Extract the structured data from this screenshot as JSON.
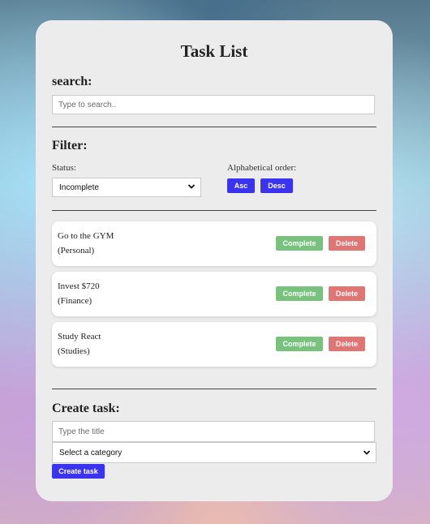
{
  "title": "Task List",
  "search": {
    "heading": "search:",
    "placeholder": "Type to search.."
  },
  "filter": {
    "heading": "Filter:",
    "status_label": "Status:",
    "status_value": "Incomplete",
    "order_label": "Alphabetical order:",
    "asc_label": "Asc",
    "desc_label": "Desc"
  },
  "tasks": [
    {
      "title": "Go to the GYM",
      "category": "(Personal)",
      "complete_label": "Complete",
      "delete_label": "Delete"
    },
    {
      "title": "Invest $720",
      "category": "(Finance)",
      "complete_label": "Complete",
      "delete_label": "Delete"
    },
    {
      "title": "Study React",
      "category": "(Studies)",
      "complete_label": "Complete",
      "delete_label": "Delete"
    }
  ],
  "create": {
    "heading": "Create task:",
    "title_placeholder": "Type the title",
    "category_value": "Select a category",
    "submit_label": "Create task"
  },
  "colors": {
    "primary_button": "#3a33f0",
    "complete_button": "#78c27d",
    "delete_button": "#e07573",
    "card_background": "#ececec"
  }
}
